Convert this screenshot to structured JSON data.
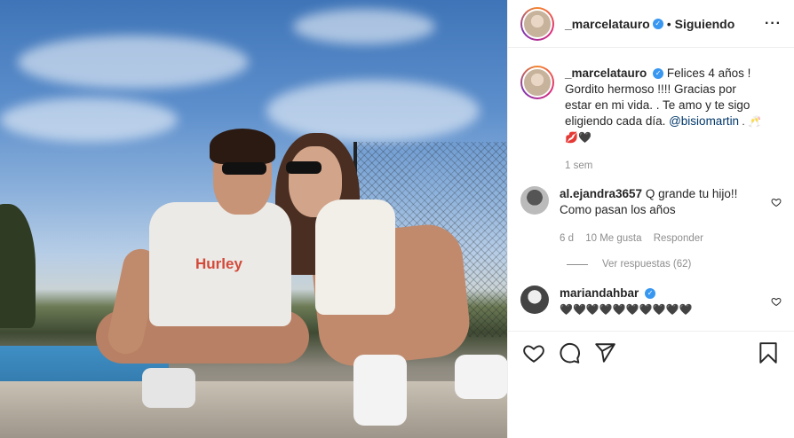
{
  "photo": {
    "shirt_text": "Hurley"
  },
  "post": {
    "username": "_marcelatauro",
    "follow_status": "Siguiendo",
    "separator": "•",
    "more_icon": "more-horizontal-icon"
  },
  "caption": {
    "username": "_marcelatauro",
    "text": "Felices 4 años ! Gordito hermoso !!!! Gracias por estar en mi vida. . Te amo y te sigo eligiendo cada día. ",
    "mention": "@bisiomartin",
    "tail": " . 🥂💋🖤",
    "time": "1 sem"
  },
  "comments": [
    {
      "username": "al.ejandra3657",
      "text": "Q grande tu hijo!! Como pasan los años",
      "time": "6 d",
      "likes": "10 Me gusta",
      "reply": "Responder",
      "view_replies": "Ver respuestas (62)"
    },
    {
      "username": "mariandahbar",
      "text": "🖤🖤🖤🖤🖤🖤🖤🖤🖤🖤"
    }
  ],
  "colors": {
    "verified": "#3897f0",
    "mention": "#00376b",
    "muted": "#8e8e8e"
  }
}
